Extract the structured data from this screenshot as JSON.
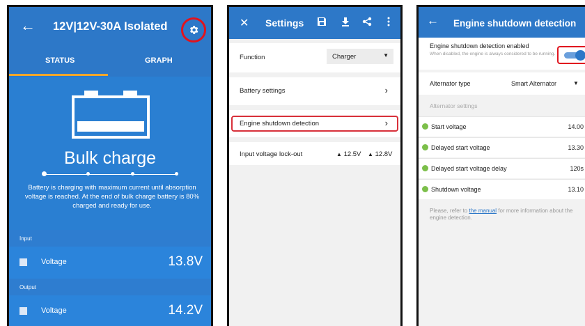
{
  "panel1": {
    "title": "12V|12V-30A Isolated",
    "tabs": [
      "STATUS",
      "GRAPH"
    ],
    "state": "Bulk charge",
    "description": "Battery is charging with maximum current until absorption voltage is reached. At the end of bulk charge battery is 80% charged and ready for use.",
    "sections": [
      {
        "label": "Input",
        "row_label": "Voltage",
        "value": "13.8V"
      },
      {
        "label": "Output",
        "row_label": "Voltage",
        "value": "14.2V"
      }
    ]
  },
  "panel2": {
    "title": "Settings",
    "function_label": "Function",
    "function_value": "Charger",
    "battery_settings": "Battery settings",
    "engine_shutdown": "Engine shutdown detection",
    "lockout_label": "Input voltage lock-out",
    "lockout_low": "12.5V",
    "lockout_high": "12.8V"
  },
  "panel3": {
    "title": "Engine shutdown detection",
    "toggle_title": "Engine shutdown detection enabled",
    "toggle_subtitle": "When disabled, the engine is always considered to be running.",
    "toggle_on": true,
    "alt_type_label": "Alternator type",
    "alt_type_value": "Smart Alternator",
    "alt_settings_header": "Alternator settings",
    "rows": [
      {
        "label": "Start voltage",
        "value": "14.00"
      },
      {
        "label": "Delayed start voltage",
        "value": "13.30"
      },
      {
        "label": "Delayed start voltage delay",
        "value": "120s"
      },
      {
        "label": "Shutdown voltage",
        "value": "13.10"
      }
    ],
    "note_before": "Please, refer to ",
    "note_link": "the manual",
    "note_after": " for more information about the engine detection."
  },
  "colors": {
    "header_blue": "#2d78c8",
    "body_blue": "#2a7fd2",
    "tab_indicator": "#f3a72b",
    "highlight_red": "#e0141e",
    "check_green": "#7cbf4a"
  },
  "icons": [
    "back-arrow-icon",
    "gear-icon",
    "battery-icon",
    "close-icon",
    "save-icon",
    "download-icon",
    "share-icon",
    "more-icon",
    "chevron-right-icon",
    "dropdown-arrow-icon",
    "bell-icon",
    "check-icon",
    "toggle-switch"
  ]
}
